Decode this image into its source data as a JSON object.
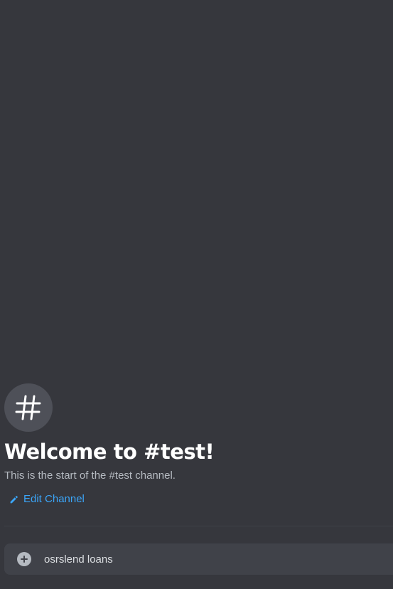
{
  "channel": {
    "name": "test",
    "icon": "hashtag-icon"
  },
  "welcome": {
    "title": "Welcome to #test!",
    "subtitle": "This is the start of the #test channel.",
    "edit_label": "Edit Channel"
  },
  "composer": {
    "value": "osrslend loans",
    "attach_icon": "plus-circle-icon"
  },
  "colors": {
    "background": "#36373d",
    "link": "#3ba5f8",
    "title": "#ffffff",
    "muted": "#b5bac1",
    "composer_bg": "#404249"
  }
}
